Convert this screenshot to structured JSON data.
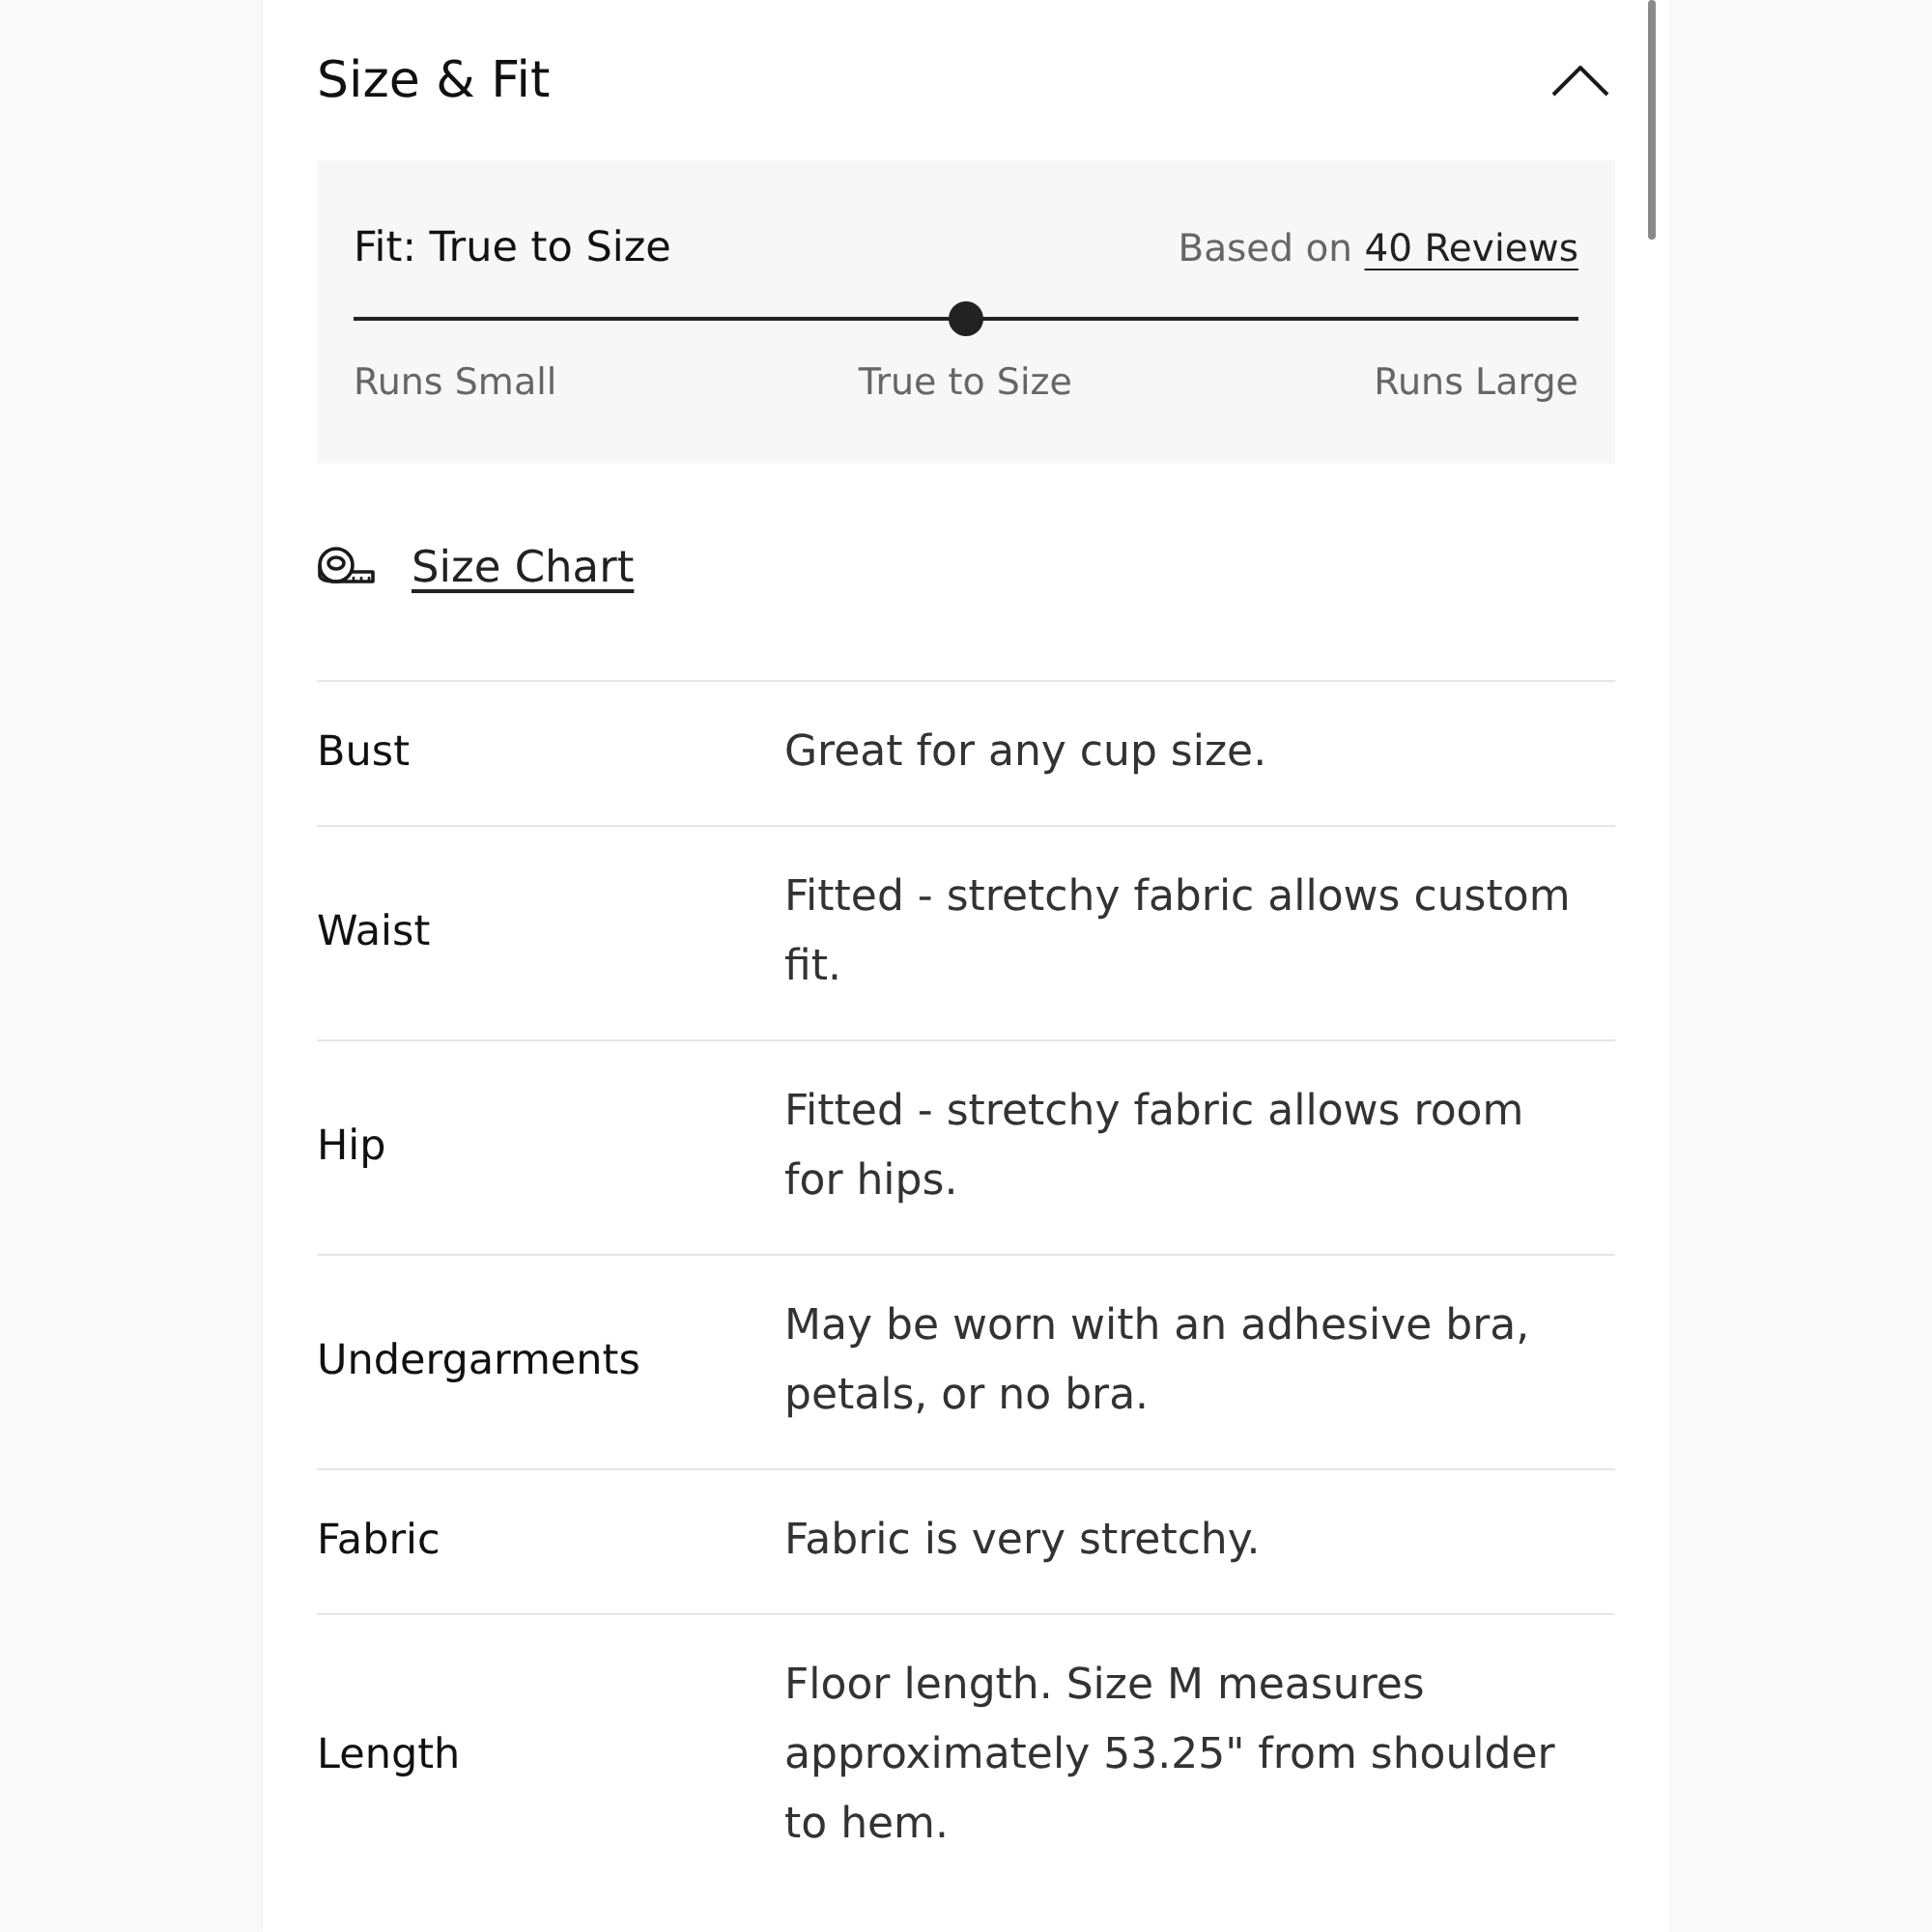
{
  "section": {
    "title": "Size & Fit",
    "expanded": true
  },
  "fit": {
    "title": "Fit: True to Size",
    "based_on": "Based on",
    "reviews_link": "40 Reviews",
    "level": 0.5,
    "scale_labels": [
      "Runs Small",
      "True to Size",
      "Runs Large"
    ]
  },
  "size_chart": {
    "label": "Size Chart"
  },
  "details": [
    {
      "label": "Bust",
      "value": "Great for any cup size."
    },
    {
      "label": "Waist",
      "value": "Fitted - stretchy fabric allows custom fit."
    },
    {
      "label": "Hip",
      "value": "Fitted - stretchy fabric allows room for hips."
    },
    {
      "label": "Undergarments",
      "value": "May be worn with an adhesive bra, petals, or no bra."
    },
    {
      "label": "Fabric",
      "value": "Fabric is very stretchy."
    },
    {
      "label": "Length",
      "value": "Floor length. Size M measures approximately 53.25\" from shoulder to hem."
    }
  ]
}
